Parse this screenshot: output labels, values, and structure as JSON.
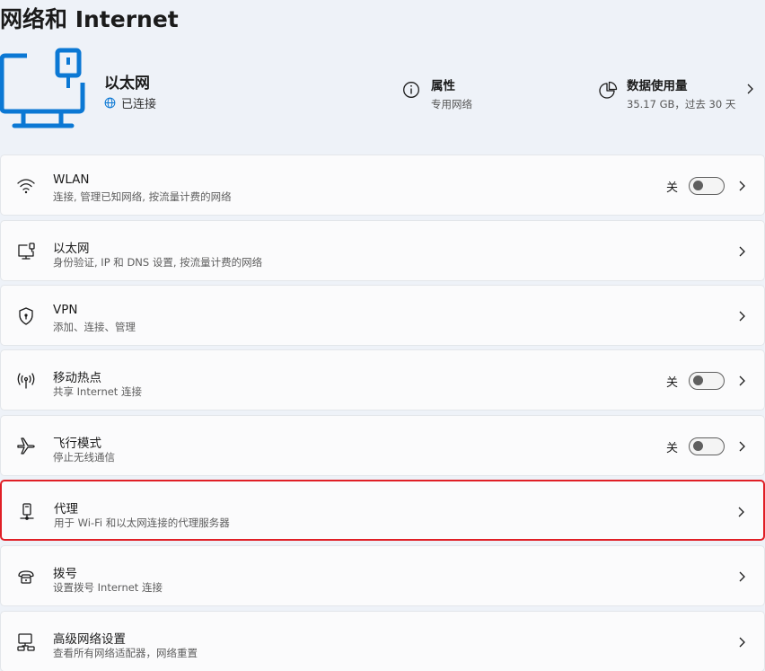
{
  "page_title": "网络和 Internet",
  "hero": {
    "name": "以太网",
    "status": "已连接",
    "properties": {
      "title": "属性",
      "subtitle": "专用网络"
    },
    "data_usage": {
      "title": "数据使用量",
      "subtitle": "35.17 GB，过去 30 天"
    }
  },
  "items": [
    {
      "icon": "wifi-icon",
      "title": "WLAN",
      "subtitle": "连接, 管理已知网络, 按流量计费的网络",
      "toggle": "关"
    },
    {
      "icon": "ethernet-icon",
      "title": "以太网",
      "subtitle": "身份验证, IP 和 DNS 设置, 按流量计费的网络"
    },
    {
      "icon": "vpn-shield-icon",
      "title": "VPN",
      "subtitle": "添加、连接、管理"
    },
    {
      "icon": "hotspot-icon",
      "title": "移动热点",
      "subtitle": "共享 Internet 连接",
      "toggle": "关"
    },
    {
      "icon": "airplane-icon",
      "title": "飞行模式",
      "subtitle": "停止无线通信",
      "toggle": "关"
    },
    {
      "icon": "proxy-icon",
      "title": "代理",
      "subtitle": "用于 Wi-Fi 和以太网连接的代理服务器",
      "selected": true
    },
    {
      "icon": "dialup-icon",
      "title": "拨号",
      "subtitle": "设置拨号 Internet 连接"
    },
    {
      "icon": "advanced-network-icon",
      "title": "高级网络设置",
      "subtitle": "查看所有网络适配器，网络重置"
    }
  ],
  "colors": {
    "accent": "#0067c0",
    "highlight_border": "#e01f26",
    "background": "#eef2f8",
    "card": "#fbfbfc"
  }
}
